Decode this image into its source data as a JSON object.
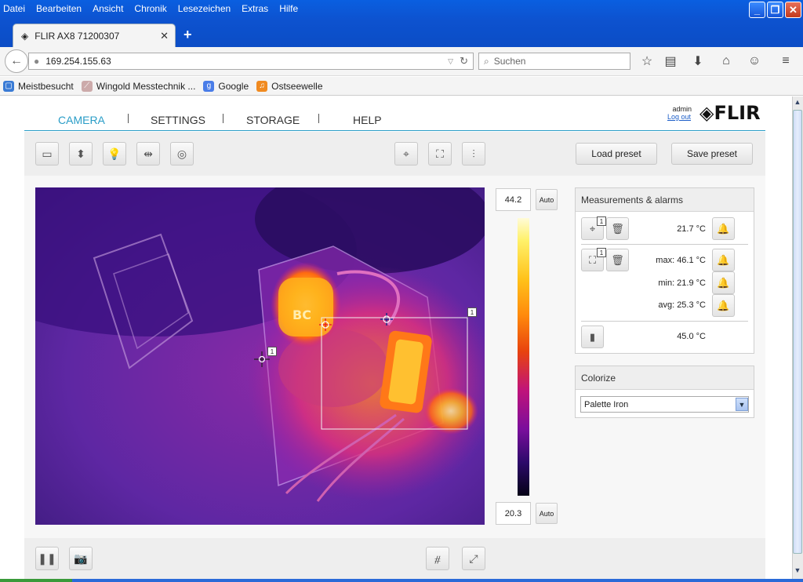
{
  "window": {
    "menu": [
      "Datei",
      "Bearbeiten",
      "Ansicht",
      "Chronik",
      "Lesezeichen",
      "Extras",
      "Hilfe"
    ],
    "tab_title": "FLIR AX8 71200307",
    "url": "169.254.155.63",
    "search_placeholder": "Suchen",
    "bookmarks": [
      "Meistbesucht",
      "Wingold Messtechnik ...",
      "Google",
      "Ostseewelle"
    ]
  },
  "app": {
    "nav": [
      "CAMERA",
      "SETTINGS",
      "STORAGE",
      "HELP"
    ],
    "active_nav": "CAMERA",
    "user": "admin",
    "logout": "Log out",
    "logo": "FLIR",
    "toolbar": {
      "load_preset": "Load preset",
      "save_preset": "Save preset"
    },
    "scale": {
      "max": "44.2",
      "min": "20.3",
      "auto_top": "Auto",
      "auto_bottom": "Auto"
    },
    "image_labels": {
      "spot_index": "1",
      "box_index": "1"
    },
    "measurements": {
      "title": "Measurements & alarms",
      "spot": {
        "index": "1",
        "value": "21.7 °C"
      },
      "box": {
        "index": "1",
        "max": "max: 46.1 °C",
        "min": "min: 21.9 °C",
        "avg": "avg: 25.3 °C"
      },
      "internal": {
        "value": "45.0 °C"
      }
    },
    "colorize": {
      "title": "Colorize",
      "selected": "Palette Iron"
    }
  },
  "icons": [
    "back-icon",
    "reload-icon",
    "search-icon",
    "star-icon",
    "reading-list-icon",
    "download-icon",
    "home-icon",
    "smiley-icon",
    "menu-icon",
    "image-mode-icon",
    "vertical-flip-icon",
    "lamp-icon",
    "horizontal-flip-icon",
    "shutter-icon",
    "spot-tool-icon",
    "box-tool-icon",
    "adjust-icon",
    "pause-icon",
    "camera-icon",
    "no-overlay-icon",
    "fullscreen-icon",
    "bell-icon",
    "trash-icon"
  ],
  "colors": {
    "accent": "#2a9dc7",
    "title_bar": "#0b4cc4"
  }
}
